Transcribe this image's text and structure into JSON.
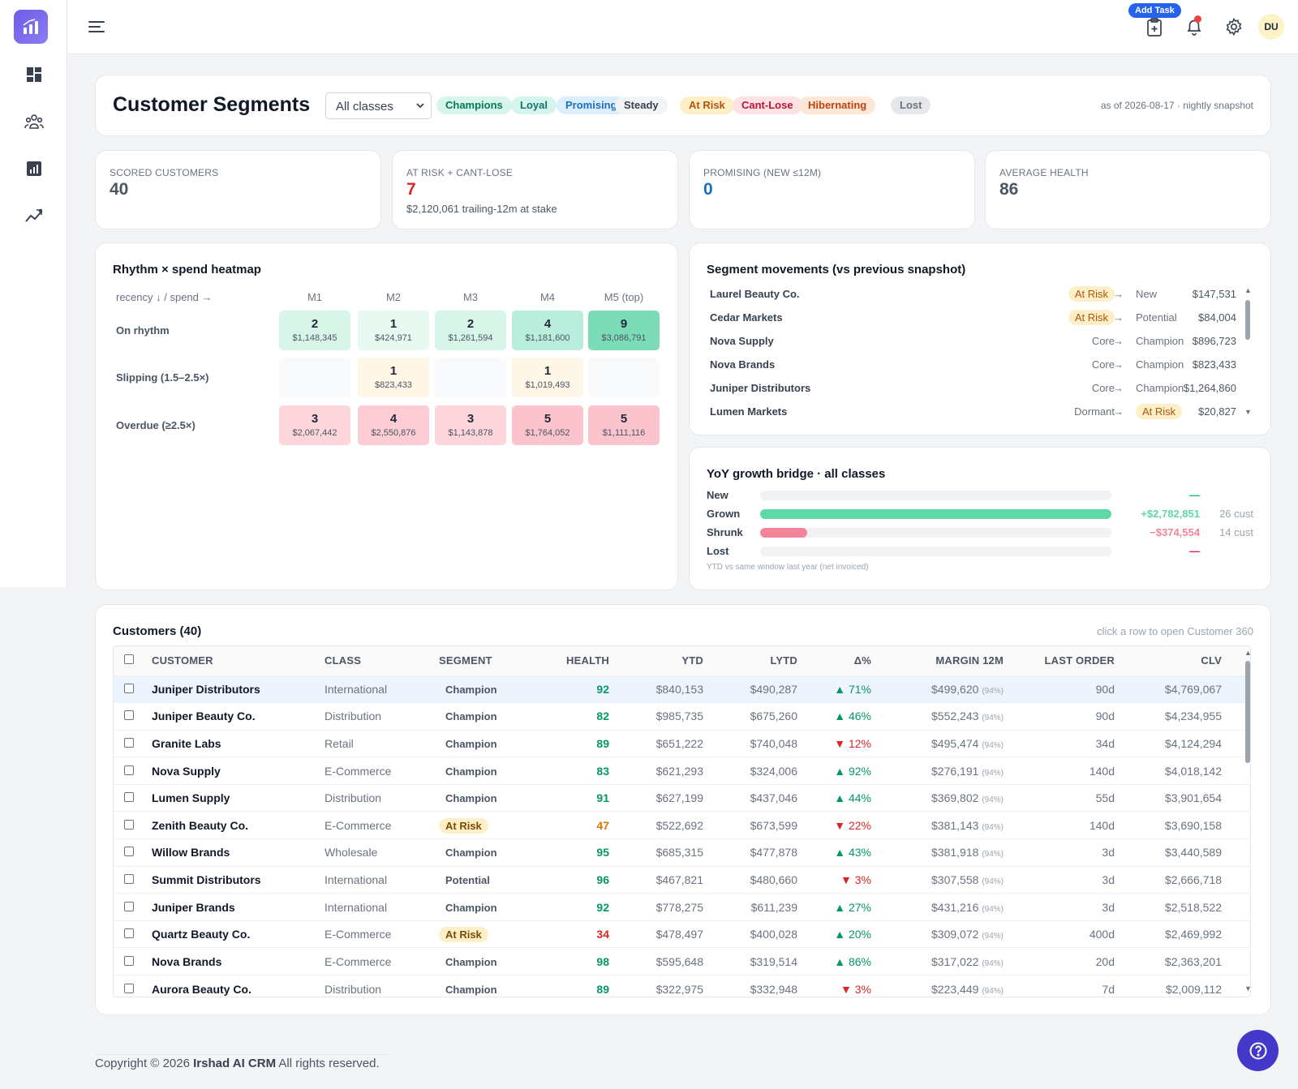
{
  "header": {
    "add_task_label": "Add Task",
    "avatar_initials": "DU"
  },
  "page": {
    "title": "Customer Segments",
    "class_filter": "All classes",
    "segment_chips": [
      {
        "label": "Champions",
        "bg": "#d7f5ea",
        "fg": "#047857"
      },
      {
        "label": "Loyal",
        "bg": "#d5f4ee",
        "fg": "#0f766e"
      },
      {
        "label": "Promising",
        "bg": "#dbeefc",
        "fg": "#1d6fb8"
      },
      {
        "label": "Steady",
        "bg": "#f3f4f6",
        "fg": "#374151"
      },
      {
        "label": "At Risk",
        "bg": "#fdf0c8",
        "fg": "#b45309"
      },
      {
        "label": "Cant-Lose",
        "bg": "#fde2e4",
        "fg": "#be123c"
      },
      {
        "label": "Hibernating",
        "bg": "#fde7d6",
        "fg": "#c2410c"
      },
      {
        "label": "Lost",
        "bg": "#e5e7eb",
        "fg": "#6b7280"
      }
    ],
    "as_of": "as of 2026-08-17 · nightly snapshot"
  },
  "kpis": [
    {
      "label": "SCORED CUSTOMERS",
      "value": "40",
      "color": "#4b5563",
      "sub": ""
    },
    {
      "label": "AT RISK + CANT-LOSE",
      "value": "7",
      "color": "#dc2626",
      "sub": "$2,120,061 trailing-12m at stake"
    },
    {
      "label": "PROMISING (NEW ≤12M)",
      "value": "0",
      "color": "#1d6fb8",
      "sub": ""
    },
    {
      "label": "AVERAGE HEALTH",
      "value": "86",
      "color": "#4b5563",
      "sub": ""
    }
  ],
  "heatmap": {
    "title": "Rhythm × spend heatmap",
    "corner": "recency ↓ / spend →",
    "columns": [
      "M1",
      "M2",
      "M3",
      "M4",
      "M5 (top)"
    ],
    "rows": [
      {
        "label": "On rhythm",
        "cells": [
          {
            "n": "2",
            "v": "$1,148,345",
            "bg": "#d8f5ea"
          },
          {
            "n": "1",
            "v": "$424,971",
            "bg": "#e8f9f1"
          },
          {
            "n": "2",
            "v": "$1,261,594",
            "bg": "#d8f5ea"
          },
          {
            "n": "4",
            "v": "$1,181,600",
            "bg": "#b8eedb"
          },
          {
            "n": "9",
            "v": "$3,086,791",
            "bg": "#7ddcb8"
          }
        ]
      },
      {
        "label": "Slipping (1.5–2.5×)",
        "cells": [
          {
            "n": "",
            "v": "",
            "bg": "#f9fafb"
          },
          {
            "n": "1",
            "v": "$823,433",
            "bg": "#fef7e8"
          },
          {
            "n": "",
            "v": "",
            "bg": "#f9fafb"
          },
          {
            "n": "1",
            "v": "$1,019,493",
            "bg": "#fef7e8"
          },
          {
            "n": "",
            "v": "",
            "bg": "#f9fafb"
          }
        ]
      },
      {
        "label": "Overdue (≥2.5×)",
        "cells": [
          {
            "n": "3",
            "v": "$2,067,442",
            "bg": "#fdd6dc"
          },
          {
            "n": "4",
            "v": "$2,550,876",
            "bg": "#fccdd4"
          },
          {
            "n": "3",
            "v": "$1,143,878",
            "bg": "#fdd6dc"
          },
          {
            "n": "5",
            "v": "$1,764,052",
            "bg": "#fbc4cd"
          },
          {
            "n": "5",
            "v": "$1,111,116",
            "bg": "#fbc4cd"
          }
        ]
      }
    ]
  },
  "movements": {
    "title": "Segment movements (vs previous snapshot)",
    "rows": [
      {
        "name": "Laurel Beauty Co.",
        "from": "At Risk",
        "to": "New",
        "amount": "$147,531"
      },
      {
        "name": "Cedar Markets",
        "from": "At Risk",
        "to": "Potential",
        "amount": "$84,004"
      },
      {
        "name": "Nova Supply",
        "from": "Core",
        "to": "Champion",
        "amount": "$896,723"
      },
      {
        "name": "Nova Brands",
        "from": "Core",
        "to": "Champion",
        "amount": "$823,433"
      },
      {
        "name": "Juniper Distributors",
        "from": "Core",
        "to": "Champion",
        "amount": "$1,264,860"
      },
      {
        "name": "Lumen Markets",
        "from": "Dormant",
        "to": "At Risk",
        "amount": "$20,827"
      }
    ]
  },
  "bridge": {
    "title": "YoY growth bridge · all classes",
    "rows": [
      {
        "label": "New",
        "value": "—",
        "count": "",
        "fraction": 0,
        "color": "#10b981"
      },
      {
        "label": "Grown",
        "value": "+$2,782,851",
        "count": "26 cust",
        "fraction": 1.0,
        "color": "#5fd8a8"
      },
      {
        "label": "Shrunk",
        "value": "−$374,554",
        "count": "14 cust",
        "fraction": 0.134,
        "color": "#f3849a"
      },
      {
        "label": "Lost",
        "value": "—",
        "count": "",
        "fraction": 0,
        "color": "#e11d48"
      }
    ],
    "note": "YTD vs same window last year (net invoiced)"
  },
  "customers": {
    "title": "Customers (40)",
    "hint": "click a row to open Customer 360",
    "columns": [
      "CUSTOMER",
      "CLASS",
      "SEGMENT",
      "HEALTH",
      "YTD",
      "LYTD",
      "Δ%",
      "MARGIN 12M",
      "LAST ORDER",
      "CLV"
    ],
    "rows": [
      {
        "customer": "Juniper Distributors",
        "class": "International",
        "segment": "Champion",
        "health": "92",
        "ytd": "$840,153",
        "lytd": "$490,287",
        "delta": "▲ 71%",
        "margin": "$499,620",
        "margin_pct": "(94%)",
        "last_order": "90d",
        "clv": "$4,769,067"
      },
      {
        "customer": "Juniper Beauty Co.",
        "class": "Distribution",
        "segment": "Champion",
        "health": "82",
        "ytd": "$985,735",
        "lytd": "$675,260",
        "delta": "▲ 46%",
        "margin": "$552,243",
        "margin_pct": "(94%)",
        "last_order": "90d",
        "clv": "$4,234,955"
      },
      {
        "customer": "Granite Labs",
        "class": "Retail",
        "segment": "Champion",
        "health": "89",
        "ytd": "$651,222",
        "lytd": "$740,048",
        "delta": "▼ 12%",
        "margin": "$495,474",
        "margin_pct": "(94%)",
        "last_order": "34d",
        "clv": "$4,124,294"
      },
      {
        "customer": "Nova Supply",
        "class": "E-Commerce",
        "segment": "Champion",
        "health": "83",
        "ytd": "$621,293",
        "lytd": "$324,006",
        "delta": "▲ 92%",
        "margin": "$276,191",
        "margin_pct": "(94%)",
        "last_order": "140d",
        "clv": "$4,018,142"
      },
      {
        "customer": "Lumen Supply",
        "class": "Distribution",
        "segment": "Champion",
        "health": "91",
        "ytd": "$627,199",
        "lytd": "$437,046",
        "delta": "▲ 44%",
        "margin": "$369,802",
        "margin_pct": "(94%)",
        "last_order": "55d",
        "clv": "$3,901,654"
      },
      {
        "customer": "Zenith Beauty Co.",
        "class": "E-Commerce",
        "segment": "At Risk",
        "health": "47",
        "ytd": "$522,692",
        "lytd": "$673,599",
        "delta": "▼ 22%",
        "margin": "$381,143",
        "margin_pct": "(94%)",
        "last_order": "140d",
        "clv": "$3,690,158"
      },
      {
        "customer": "Willow Brands",
        "class": "Wholesale",
        "segment": "Champion",
        "health": "95",
        "ytd": "$685,315",
        "lytd": "$477,878",
        "delta": "▲ 43%",
        "margin": "$381,918",
        "margin_pct": "(94%)",
        "last_order": "3d",
        "clv": "$3,440,589"
      },
      {
        "customer": "Summit Distributors",
        "class": "International",
        "segment": "Potential",
        "health": "96",
        "ytd": "$467,821",
        "lytd": "$480,660",
        "delta": "▼ 3%",
        "margin": "$307,558",
        "margin_pct": "(94%)",
        "last_order": "3d",
        "clv": "$2,666,718"
      },
      {
        "customer": "Juniper Brands",
        "class": "International",
        "segment": "Champion",
        "health": "92",
        "ytd": "$778,275",
        "lytd": "$611,239",
        "delta": "▲ 27%",
        "margin": "$431,216",
        "margin_pct": "(94%)",
        "last_order": "3d",
        "clv": "$2,518,522"
      },
      {
        "customer": "Quartz Beauty Co.",
        "class": "E-Commerce",
        "segment": "At Risk",
        "health": "34",
        "ytd": "$478,497",
        "lytd": "$400,028",
        "delta": "▲ 20%",
        "margin": "$309,072",
        "margin_pct": "(94%)",
        "last_order": "400d",
        "clv": "$2,469,992"
      },
      {
        "customer": "Nova Brands",
        "class": "E-Commerce",
        "segment": "Champion",
        "health": "98",
        "ytd": "$595,648",
        "lytd": "$319,514",
        "delta": "▲ 86%",
        "margin": "$317,022",
        "margin_pct": "(94%)",
        "last_order": "20d",
        "clv": "$2,363,201"
      },
      {
        "customer": "Aurora Beauty Co.",
        "class": "Distribution",
        "segment": "Champion",
        "health": "89",
        "ytd": "$322,975",
        "lytd": "$332,948",
        "delta": "▼ 3%",
        "margin": "$223,449",
        "margin_pct": "(94%)",
        "last_order": "7d",
        "clv": "$2,009,112"
      }
    ]
  },
  "footer": {
    "prefix": "Copyright © 2026 ",
    "brand": "Irshad AI CRM",
    "suffix": " All rights reserved."
  },
  "colors": {
    "up": "#059669",
    "down": "#dc2626",
    "health_good": "#059669",
    "health_warn": "#d97706",
    "health_bad": "#dc2626"
  }
}
